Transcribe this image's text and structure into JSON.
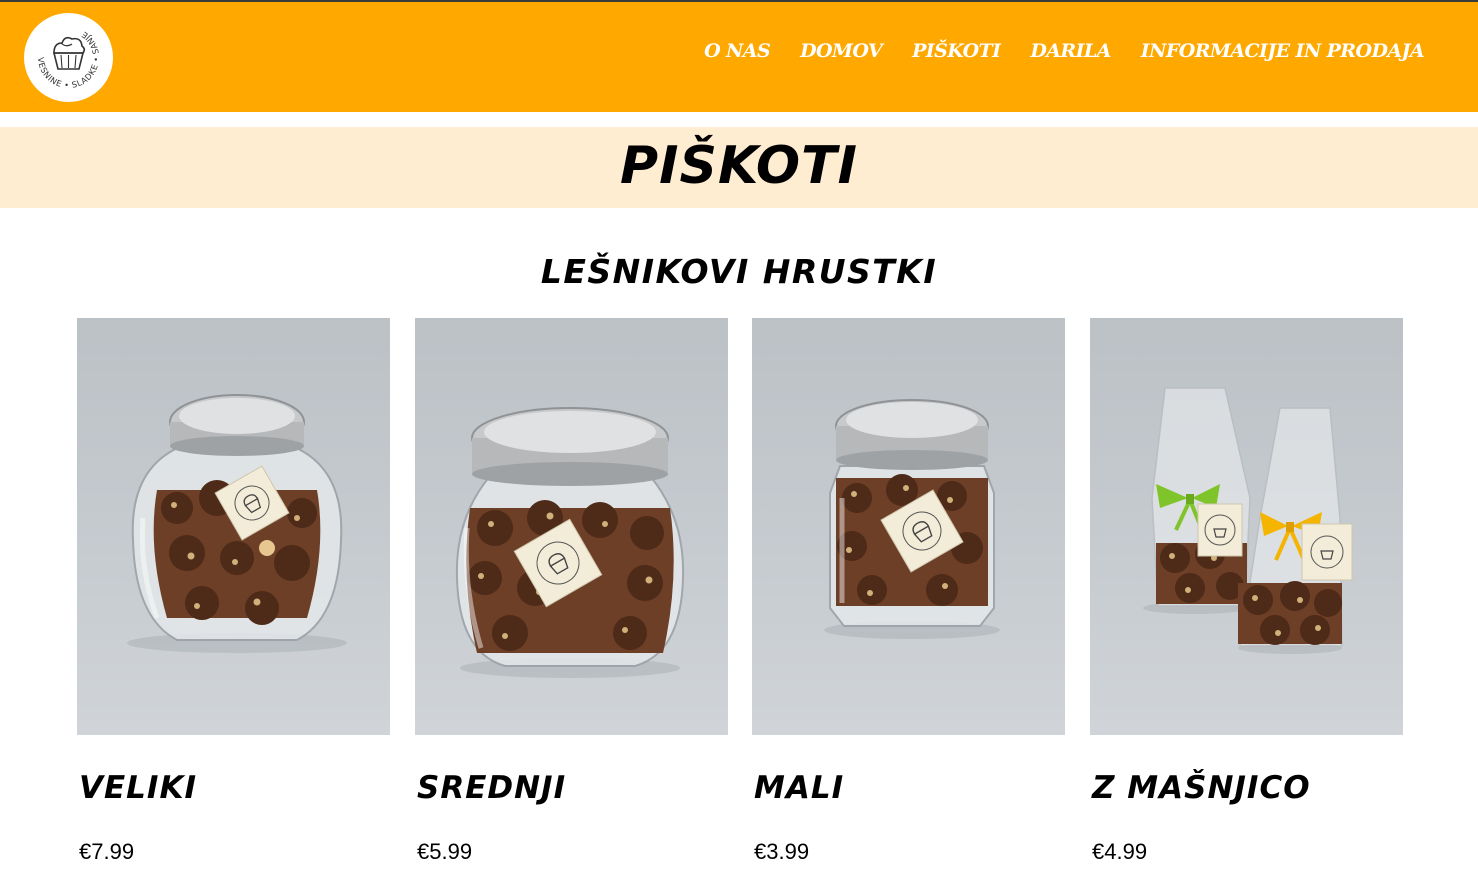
{
  "header": {
    "logo_text": "VESNINE • SLADKE • SANJE",
    "nav": [
      "O NAS",
      "DOMOV",
      "PIŠKOTI",
      "DARILA",
      "INFORMACIJE IN PRODAJA"
    ]
  },
  "page_title": "PIŠKOTI",
  "section_title": "LEŠNIKOVI HRUSTKI",
  "products": [
    {
      "name": "VELIKI",
      "price": "€7.99"
    },
    {
      "name": "SREDNJI",
      "price": "€5.99"
    },
    {
      "name": "MALI",
      "price": "€3.99"
    },
    {
      "name": "Z MAŠNJICO",
      "price": "€4.99"
    }
  ],
  "colors": {
    "header_bg": "#ffa800",
    "title_band_bg": "#ffedd2",
    "nav_text": "#ffffff",
    "photo_bg": "#c4c9ce"
  }
}
